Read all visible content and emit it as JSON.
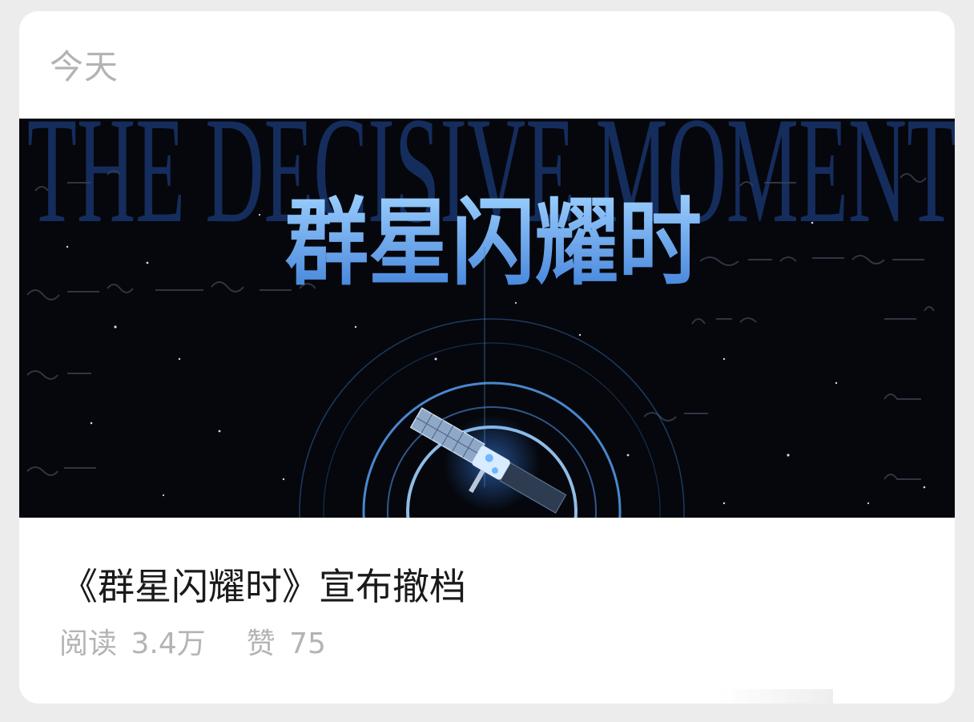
{
  "date_label": "今天",
  "article": {
    "cover": {
      "background_text": "THE DECISIVE MOMENT",
      "headline": "群星闪耀时",
      "image_description_icon": "satellite-icon"
    },
    "title": "《群星闪耀时》宣布撤档",
    "stats": {
      "read_label": "阅读",
      "read_count": "3.4万",
      "like_label": "赞",
      "like_count": "75"
    }
  },
  "colors": {
    "card_bg": "#ffffff",
    "page_bg": "#ececec",
    "muted_text": "#b3b3b3",
    "title_text": "#1a1a1a",
    "headline_blue": "#4e9ff0"
  }
}
